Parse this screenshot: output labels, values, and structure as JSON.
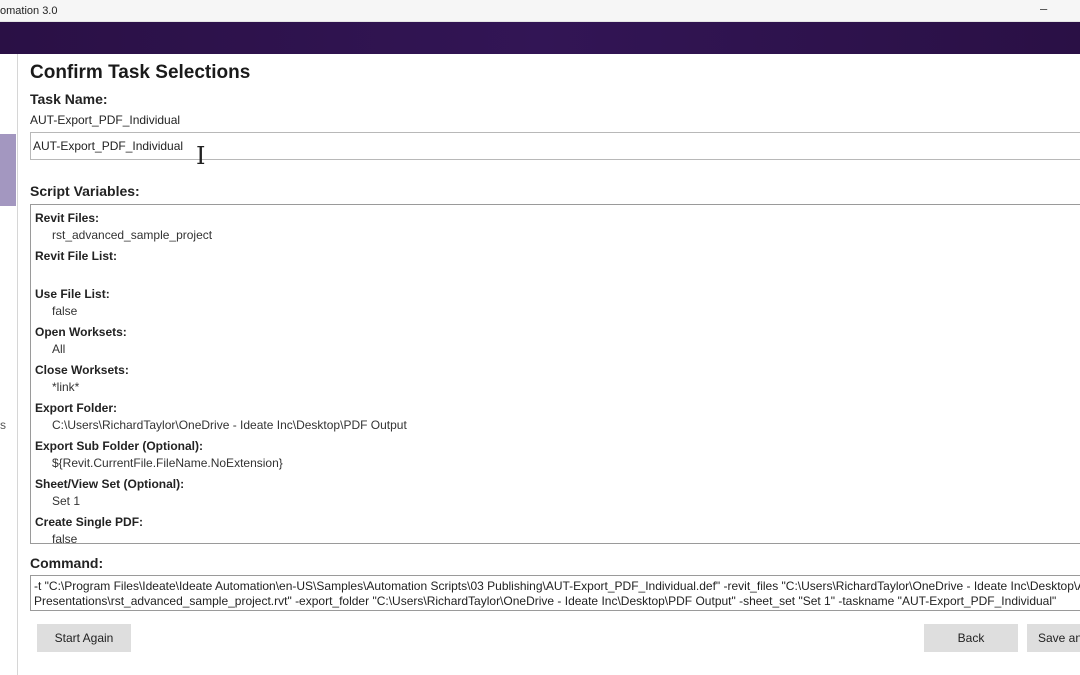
{
  "window": {
    "title": "omation 3.0",
    "minimize_glyph": "–"
  },
  "sidebar": {
    "partial_label": "s"
  },
  "page": {
    "title": "Confirm Task Selections"
  },
  "task_name": {
    "label": "Task Name:",
    "display_value": "AUT-Export_PDF_Individual",
    "input_value": "AUT-Export_PDF_Individual"
  },
  "script_variables": {
    "label": "Script Variables:",
    "items": [
      {
        "label": "Revit Files:",
        "value": "rst_advanced_sample_project"
      },
      {
        "label": "Revit File List:",
        "value": ""
      },
      {
        "label": "Use File List:",
        "value": "false"
      },
      {
        "label": "Open Worksets:",
        "value": "All"
      },
      {
        "label": "Close Worksets:",
        "value": "*link*"
      },
      {
        "label": "Export Folder:",
        "value": "C:\\Users\\RichardTaylor\\OneDrive - Ideate Inc\\Desktop\\PDF Output"
      },
      {
        "label": "Export Sub Folder (Optional):",
        "value": "${Revit.CurrentFile.FileName.NoExtension}"
      },
      {
        "label": "Sheet/View Set (Optional):",
        "value": "Set 1"
      },
      {
        "label": "Create Single PDF:",
        "value": "false"
      }
    ]
  },
  "command": {
    "label": "Command:",
    "line1": "-t \"C:\\Program Files\\Ideate\\Ideate Automation\\en-US\\Samples\\Automation Scripts\\03 Publishing\\AUT-Export_PDF_Individual.def\" -revit_files \"C:\\Users\\RichardTaylor\\OneDrive - Ideate Inc\\Desktop\\Australia",
    "line2": "Presentations\\rst_advanced_sample_project.rvt\" -export_folder \"C:\\Users\\RichardTaylor\\OneDrive - Ideate Inc\\Desktop\\PDF Output\" -sheet_set \"Set 1\" -taskname \"AUT-Export_PDF_Individual\""
  },
  "buttons": {
    "start_again": "Start Again",
    "back": "Back",
    "save": "Save and"
  }
}
